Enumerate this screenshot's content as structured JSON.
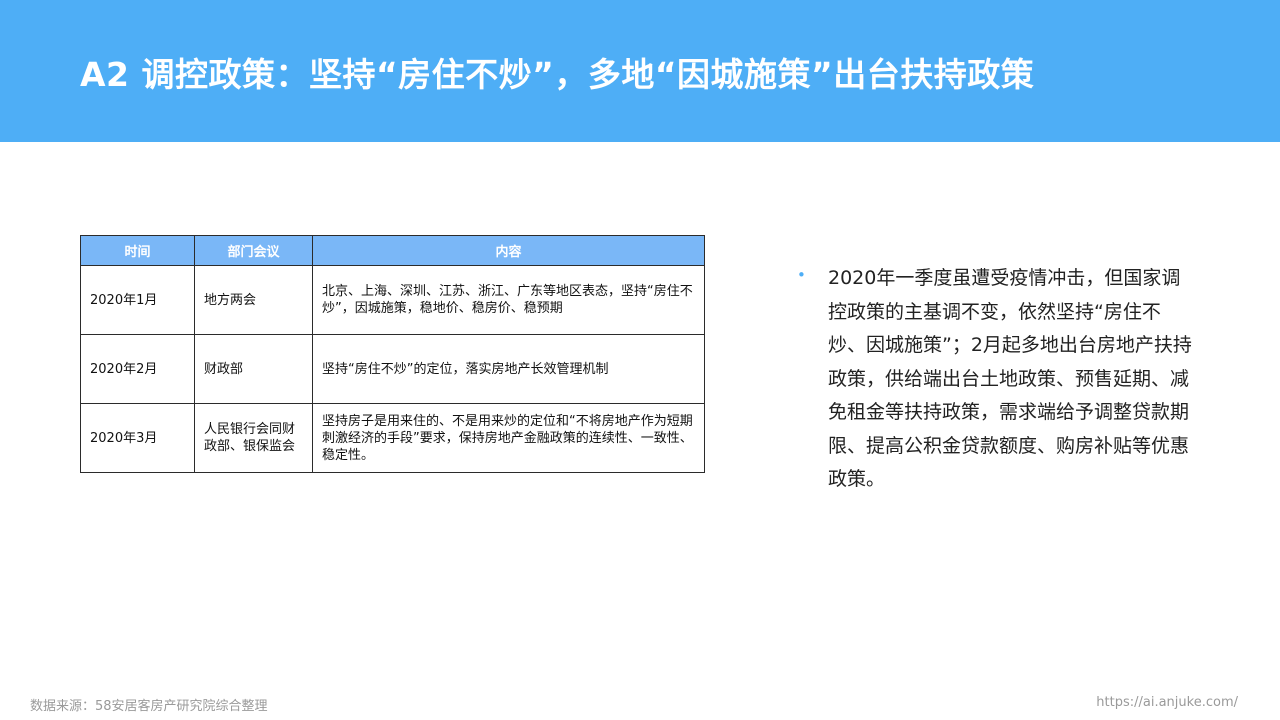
{
  "header": {
    "title": "A2 调控政策：坚持“房住不炒”，多地“因城施策”出台扶持政策"
  },
  "table": {
    "columns": [
      "时间",
      "部门会议",
      "内容"
    ],
    "rows": [
      {
        "time": "2020年1月",
        "dept": "地方两会",
        "content": "北京、上海、深圳、江苏、浙江、广东等地区表态，坚持“房住不炒”，因城施策，稳地价、稳房价、稳预期"
      },
      {
        "time": "2020年2月",
        "dept": "财政部",
        "content": "坚持“房住不炒”的定位，落实房地产长效管理机制"
      },
      {
        "time": "2020年3月",
        "dept": "人民银行会同财政部、银保监会",
        "content": "坚持房子是用来住的、不是用来炒的定位和“不将房地产作为短期刺激经济的手段”要求，保持房地产金融政策的连续性、一致性、稳定性。"
      }
    ]
  },
  "summary": {
    "bullet": "•",
    "text": "2020年一季度虽遭受疫情冲击，但国家调控政策的主基调不变，依然坚持“房住不炒、因城施策”；2月起多地出台房地产扶持政策，供给端出台土地政策、预售延期、减免租金等扶持政策，需求端给予调整贷款期限、提高公积金贷款额度、购房补贴等优惠政策。"
  },
  "footer": {
    "source": "数据来源：58安居客房产研究院综合整理",
    "url": "https://ai.anjuke.com/"
  },
  "colors": {
    "header_bg": "#4eaef6",
    "table_header_bg": "#7ab7f7"
  }
}
